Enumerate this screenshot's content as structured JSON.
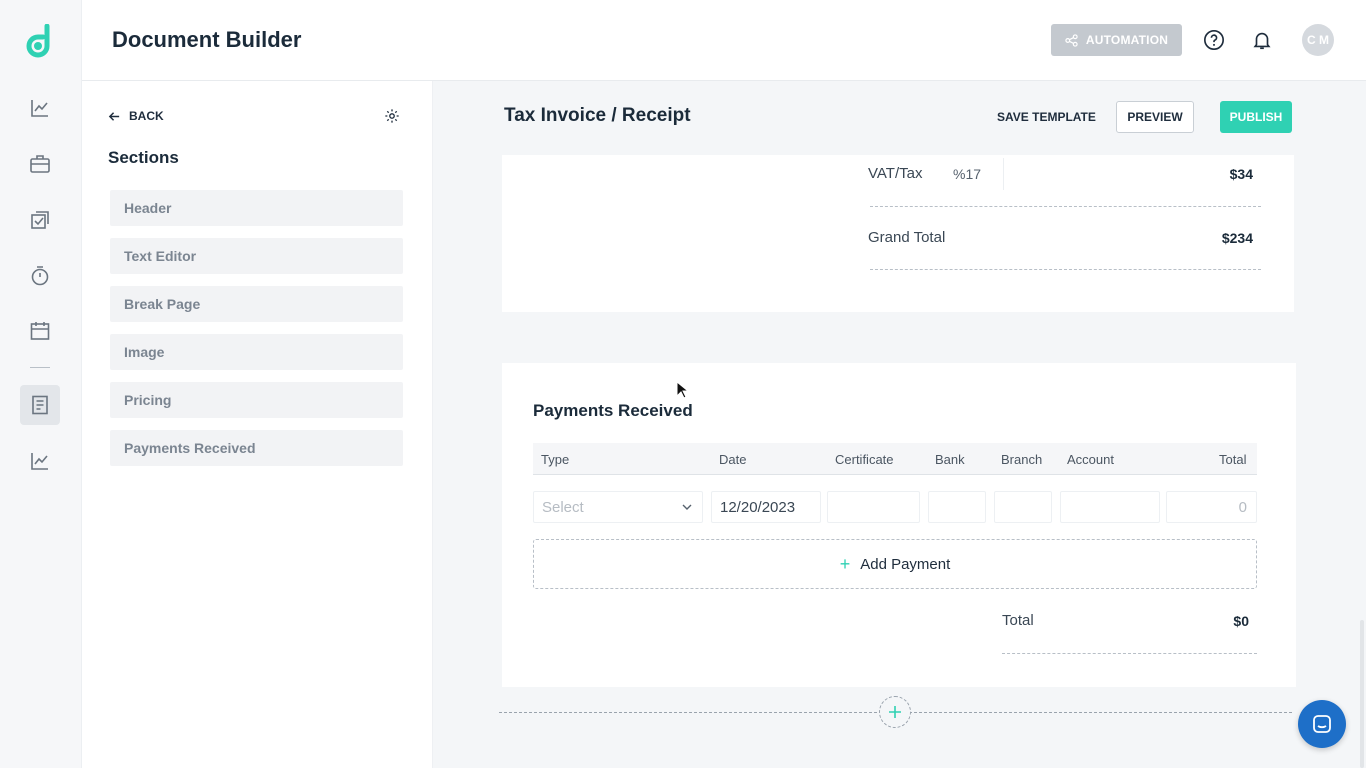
{
  "app": {
    "title": "Document Builder",
    "avatar_initials": "C M"
  },
  "topbar": {
    "automation_label": "AUTOMATION"
  },
  "rail": {
    "items": [
      "analytics-icon",
      "briefcase-icon",
      "checklist-icon",
      "stopwatch-icon",
      "calendar-icon",
      "document-icon",
      "chart-icon"
    ],
    "active": "document-icon"
  },
  "panel": {
    "back_label": "BACK",
    "sections_title": "Sections",
    "items": [
      "Header",
      "Text Editor",
      "Break Page",
      "Image",
      "Pricing",
      "Payments Received"
    ]
  },
  "doc": {
    "title": "Tax Invoice / Receipt",
    "save_template_label": "SAVE TEMPLATE",
    "preview_label": "PREVIEW",
    "publish_label": "PUBLISH"
  },
  "pricing": {
    "vat_label": "VAT/Tax",
    "vat_rate": "%17",
    "vat_value": "$34",
    "grand_total_label": "Grand Total",
    "grand_total_value": "$234"
  },
  "payments": {
    "title": "Payments Received",
    "columns": [
      "Type",
      "Date",
      "Certificate",
      "Bank",
      "Branch",
      "Account",
      "Total"
    ],
    "row": {
      "type_placeholder": "Select",
      "date": "12/20/2023",
      "total": "0"
    },
    "add_label": "Add Payment",
    "total_label": "Total",
    "total_value": "$0"
  },
  "colors": {
    "accent": "#2fd1b3",
    "chat": "#1e6fc8",
    "automation_bg": "#c4c9cf"
  }
}
